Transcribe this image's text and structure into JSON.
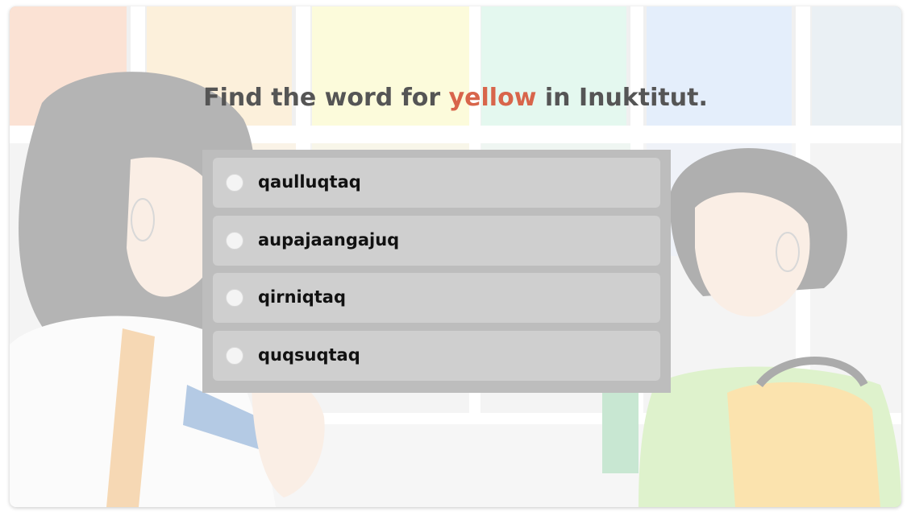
{
  "question": {
    "prefix": "Find the word for ",
    "highlight": "yellow",
    "suffix": " in Inuktitut.",
    "highlight_color": "#d8654b"
  },
  "choices": [
    {
      "label": "qaulluqtaq"
    },
    {
      "label": "aupajaangajuq"
    },
    {
      "label": "qirniqtaq"
    },
    {
      "label": "quqsuqtaq"
    }
  ],
  "background": {
    "description_icon": "paint-chip-store-illustration-icon"
  }
}
